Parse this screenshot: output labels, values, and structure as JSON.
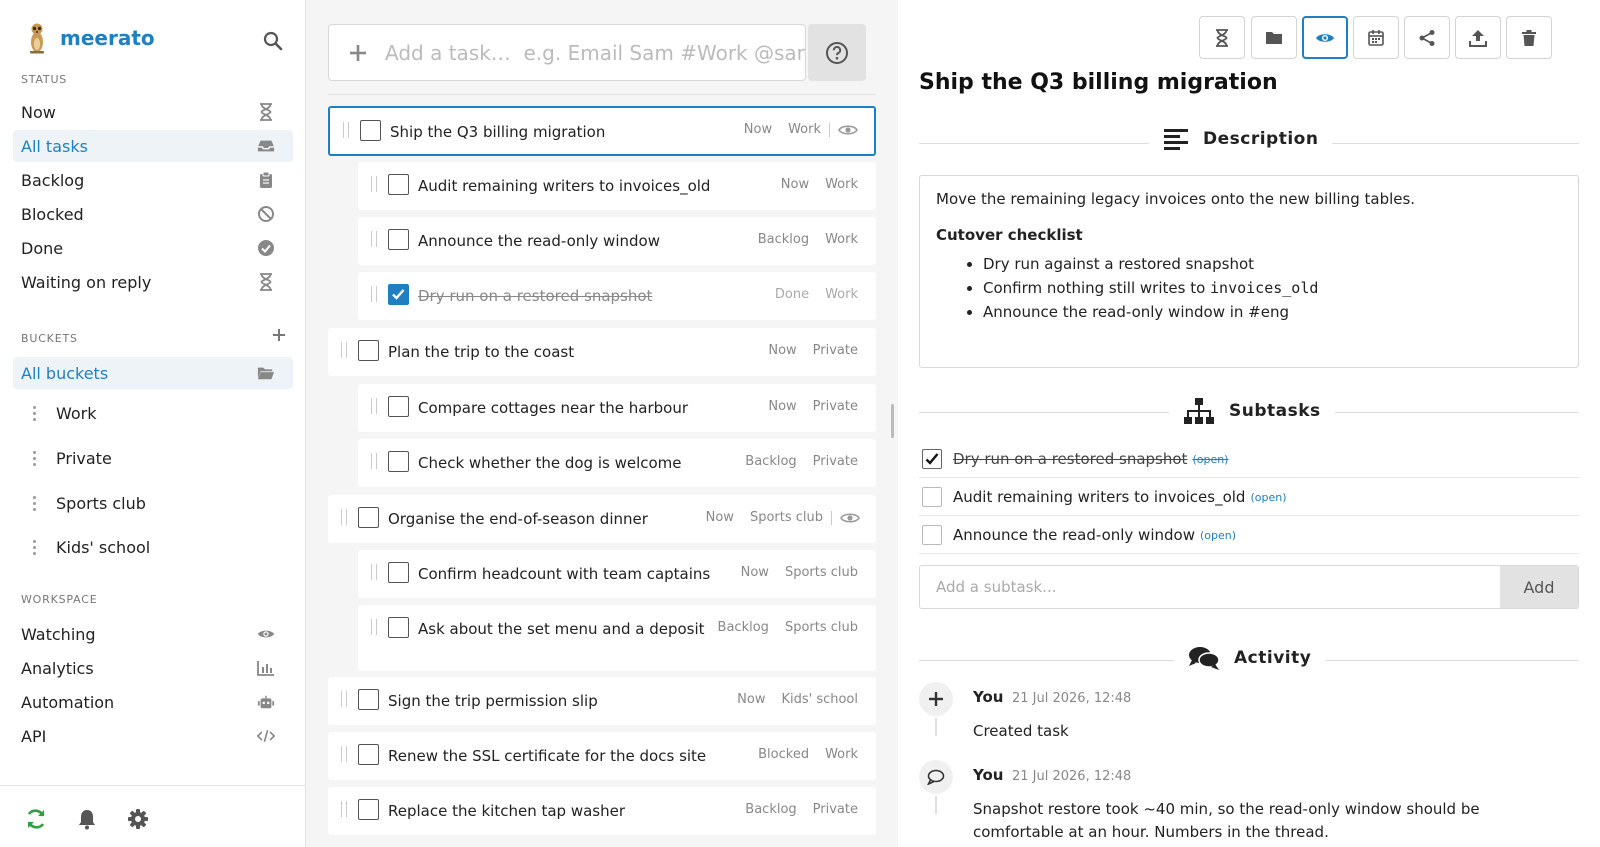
{
  "app": {
    "name": "meerato"
  },
  "sidebar": {
    "status_label": "STATUS",
    "status_items": [
      {
        "label": "Now",
        "icon": "hourglass-icon"
      },
      {
        "label": "All tasks",
        "icon": "inbox-icon",
        "active": true
      },
      {
        "label": "Backlog",
        "icon": "clipboard-icon"
      },
      {
        "label": "Blocked",
        "icon": "blocked-icon"
      },
      {
        "label": "Done",
        "icon": "check-circle-icon"
      },
      {
        "label": "Waiting on reply",
        "icon": "hourglass-icon"
      }
    ],
    "buckets_label": "BUCKETS",
    "all_buckets_label": "All buckets",
    "buckets": [
      "Work",
      "Private",
      "Sports club",
      "Kids' school"
    ],
    "workspace_label": "WORKSPACE",
    "workspace_items": [
      {
        "label": "Watching",
        "icon": "eye-icon"
      },
      {
        "label": "Analytics",
        "icon": "chart-icon"
      },
      {
        "label": "Automation",
        "icon": "robot-icon"
      },
      {
        "label": "API",
        "icon": "code-icon"
      }
    ]
  },
  "task_input": {
    "placeholder": "Add a task…  e.g. Email Sam #Work @sam"
  },
  "tasks": [
    {
      "title": "Ship the Q3 billing migration",
      "status": "Now",
      "bucket": "Work",
      "watched": true,
      "selected": true,
      "level": 0
    },
    {
      "title": "Audit remaining writers to invoices_old",
      "status": "Now",
      "bucket": "Work",
      "level": 1
    },
    {
      "title": "Announce the read-only window",
      "status": "Backlog",
      "bucket": "Work",
      "level": 1
    },
    {
      "title": "Dry run on a restored snapshot",
      "status": "Done",
      "bucket": "Work",
      "level": 1,
      "done": true
    },
    {
      "title": "Plan the trip to the coast",
      "status": "Now",
      "bucket": "Private",
      "level": 0
    },
    {
      "title": "Compare cottages near the harbour",
      "status": "Now",
      "bucket": "Private",
      "level": 1
    },
    {
      "title": "Check whether the dog is welcome",
      "status": "Backlog",
      "bucket": "Private",
      "level": 1
    },
    {
      "title": "Organise the end-of-season dinner",
      "status": "Now",
      "bucket": "Sports club",
      "watched": true,
      "level": 0
    },
    {
      "title": "Confirm headcount with team captains",
      "status": "Now",
      "bucket": "Sports club",
      "level": 1
    },
    {
      "title": "Ask about the set menu and a deposit",
      "status": "Backlog",
      "bucket": "Sports club",
      "level": 1
    },
    {
      "title": "Sign the trip permission slip",
      "status": "Now",
      "bucket": "Kids' school",
      "level": 0
    },
    {
      "title": "Renew the SSL certificate for the docs site",
      "status": "Blocked",
      "bucket": "Work",
      "level": 0
    },
    {
      "title": "Replace the kitchen tap washer",
      "status": "Backlog",
      "bucket": "Private",
      "level": 0
    }
  ],
  "detail": {
    "title": "Ship the Q3 billing migration",
    "toolbar": [
      "hourglass-icon",
      "folder-icon",
      "eye-icon",
      "calendar-icon",
      "share-icon",
      "upload-icon",
      "trash-icon"
    ],
    "description_label": "Description",
    "description": {
      "intro": "Move the remaining legacy invoices onto the new billing tables.",
      "checklist_title": "Cutover checklist",
      "checklist": [
        {
          "text": "Dry run against a restored snapshot"
        },
        {
          "text": "Confirm nothing still writes to ",
          "code": "invoices_old"
        },
        {
          "text": "Announce the read-only window in #eng"
        }
      ]
    },
    "subtasks_label": "Subtasks",
    "subtasks": [
      {
        "label": "Dry run on a restored snapshot",
        "link": "(open)",
        "done": true
      },
      {
        "label": "Audit remaining writers to invoices_old",
        "link": "(open)",
        "done": false
      },
      {
        "label": "Announce the read-only window",
        "link": "(open)",
        "done": false
      }
    ],
    "subtask_placeholder": "Add a subtask...",
    "subtask_add_label": "Add",
    "activity_label": "Activity",
    "activity": [
      {
        "author": "You",
        "time": "21 Jul 2026, 12:48",
        "text": "Created task",
        "icon": "plus-icon"
      },
      {
        "author": "You",
        "time": "21 Jul 2026, 12:48",
        "text": "Snapshot restore took ~40 min, so the read-only window should be comfortable at an hour. Numbers in the thread.",
        "icon": "comment-icon"
      }
    ]
  },
  "colors": {
    "accent": "#1f7fc0",
    "refresh": "#2ea043"
  }
}
